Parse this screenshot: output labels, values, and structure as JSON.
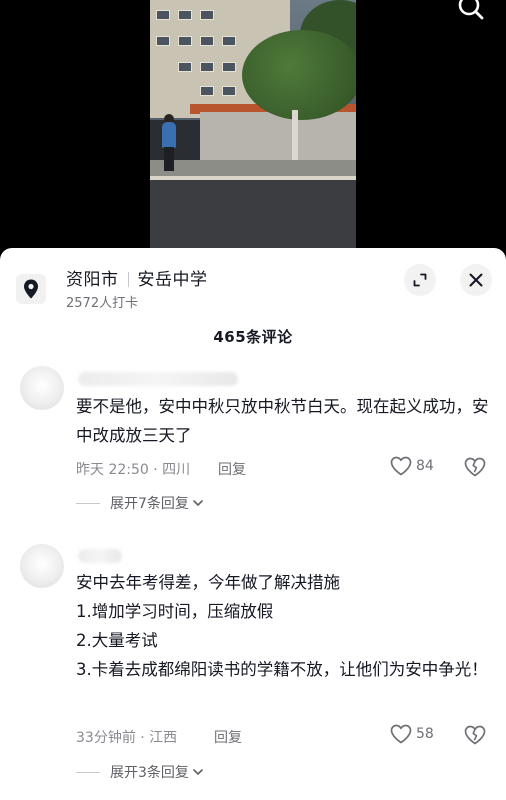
{
  "location": {
    "city": "资阳市",
    "name": "安岳中学",
    "checkins": "2572人打卡"
  },
  "comments_header": "465条评论",
  "comments": [
    {
      "text": "要不是他，安中中秋只放中秋节白天。现在起义成功，安中改成放三天了",
      "time_region": "昨天 22:50 · 四川",
      "reply_label": "回复",
      "likes": "84",
      "expand_replies": "展开7条回复"
    },
    {
      "text": "安中去年考得差，今年做了解决措施\n1.增加学习时间，压缩放假\n2.大量考试\n3.卡着去成都绵阳读书的学籍不放，让他们为安中争光！",
      "time_region": "33分钟前 · 江西",
      "reply_label": "回复",
      "likes": "58",
      "expand_replies": "展开3条回复"
    }
  ],
  "icons": {
    "search": "search-icon",
    "location": "location-pin-icon",
    "expand": "expand-icon",
    "close": "close-icon",
    "like": "heart-icon",
    "dislike": "broken-heart-icon",
    "chevron": "chevron-down-icon"
  }
}
